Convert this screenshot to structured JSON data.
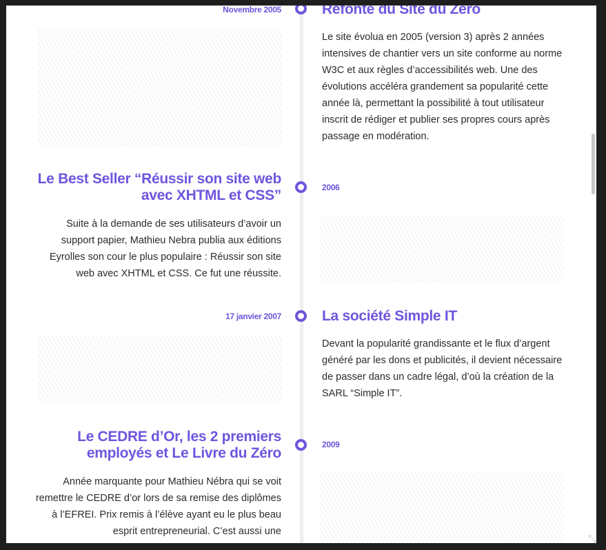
{
  "colors": {
    "accent": "#6f55de",
    "text": "#2b2b2b",
    "timeline": "#eeeeee"
  },
  "events": [
    {
      "date": "Novembre 2005",
      "title": "Refonte du Site du Zéro",
      "body": "Le site évolua en 2005 (version 3) après 2 années intensives de chantier vers un site conforme au norme W3C et aux règles d’accessibilités web. Une des évolutions accéléra grandement sa popularité cette année là, permettant la possibilité à tout utilisateur inscrit de rédiger et publier ses propres cours après passage en modération."
    },
    {
      "date": "2006",
      "title": "Le Best Seller “Réussir son site web avec XHTML et CSS”",
      "body": "Suite à la demande de ses utilisateurs d’avoir un support papier, Mathieu Nebra publia aux éditions Eyrolles son cour le plus populaire : Réussir son site web avec XHTML et CSS. Ce fut une réussite."
    },
    {
      "date": "17 janvier 2007",
      "title": "La société Simple IT",
      "body": "Devant la popularité grandissante et le flux d’argent généré par les dons et publicités, il devient nécessaire de passer dans un cadre légal, d’où la création de la SARL “Simple IT”."
    },
    {
      "date": "2009",
      "title": "Le CEDRE d’Or, les 2 premiers employés et Le Livre du Zéro",
      "body": "Année marquante pour Mathieu Nébra qui se voit remettre le CEDRE d’or lors de sa remise des diplômes à l’EFREI. Prix remis à l’élève ayant eu le plus beau esprit entrepreneurial. C’est aussi une"
    }
  ]
}
